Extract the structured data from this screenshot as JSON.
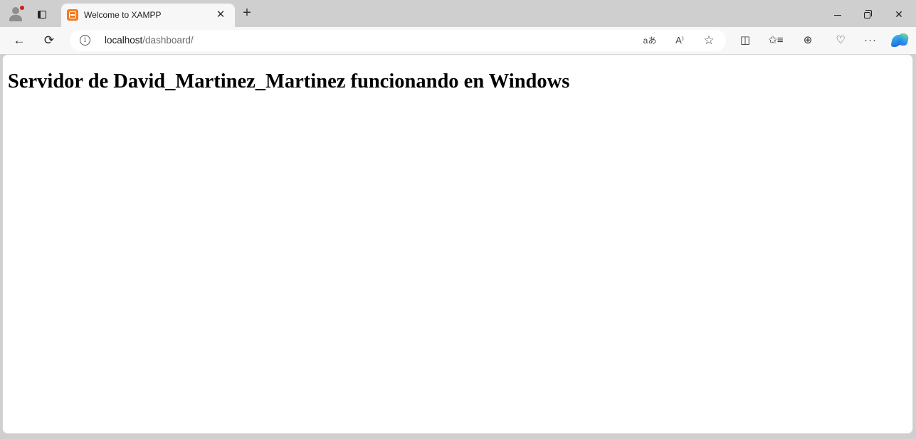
{
  "browser": {
    "tab": {
      "title": "Welcome to XAMPP",
      "favicon": "xampp-icon",
      "close_glyph": "✕"
    },
    "new_tab_glyph": "+",
    "address": {
      "host": "localhost",
      "path": "/dashboard/"
    },
    "icons": {
      "back": "←",
      "reload": "⟳",
      "translate": "aあ",
      "read_aloud": "A⁾",
      "favorite": "☆",
      "split": "◫",
      "favorites": "✩≡",
      "collections": "⊕",
      "health": "♡",
      "more": "···",
      "close": "✕"
    }
  },
  "page": {
    "heading": "Servidor de David_Martinez_Martinez funcionando en Windows"
  },
  "colors": {
    "chrome": "#cfcfcf",
    "toolbar": "#f7f7f7",
    "favicon": "#f07a20"
  }
}
